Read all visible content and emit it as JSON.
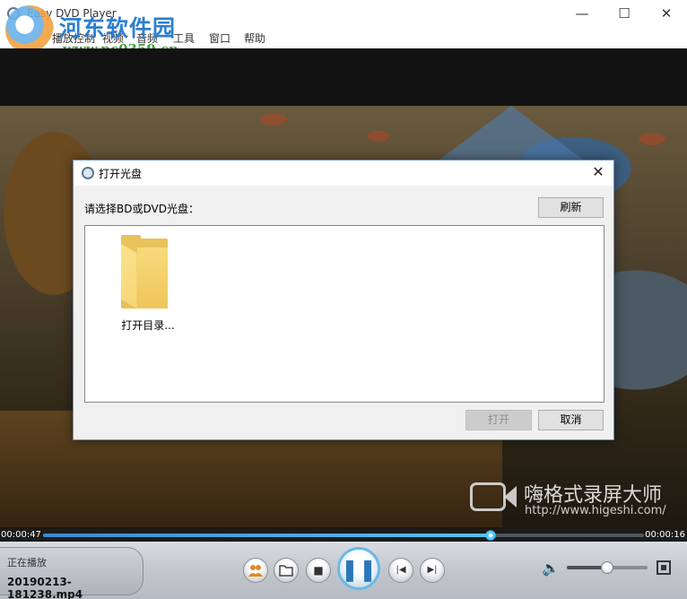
{
  "window": {
    "title": "Easy DVD Player",
    "controls": {
      "minimize": "—",
      "maximize": "☐",
      "close": "✕"
    }
  },
  "menu": [
    {
      "label": "播放控制"
    },
    {
      "label": "视频"
    },
    {
      "label": "音频"
    },
    {
      "label": "工具"
    },
    {
      "label": "窗口"
    },
    {
      "label": "帮助"
    }
  ],
  "watermark_site": {
    "title": "河东软件园",
    "url": "www.pc0359.cn"
  },
  "video_watermark": {
    "title": "嗨格式录屏大师",
    "url": "http://www.higeshi.com/"
  },
  "dialog": {
    "title": "打开光盘",
    "close_glyph": "✕",
    "prompt": "请选择BD或DVD光盘：",
    "refresh_label": "刷新",
    "items": [
      {
        "label": "打开目录...",
        "icon": "folder-icon"
      }
    ],
    "open_label": "打开",
    "cancel_label": "取消"
  },
  "playback": {
    "current_time": "00:00:47",
    "end_time": "00:00:16",
    "progress_fraction": 0.745,
    "status_label": "正在播放",
    "file_name": "20190213-181238.mp4",
    "volume_fraction": 0.5
  },
  "controls": {
    "play_pause_glyph": "❚❚",
    "stop_glyph": "■",
    "prev_glyph": "|◀",
    "next_glyph": "▶|",
    "volume_glyph": "🔈"
  },
  "colors": {
    "accent": "#4aa8e0",
    "dialog_border": "#6e8fb8"
  }
}
